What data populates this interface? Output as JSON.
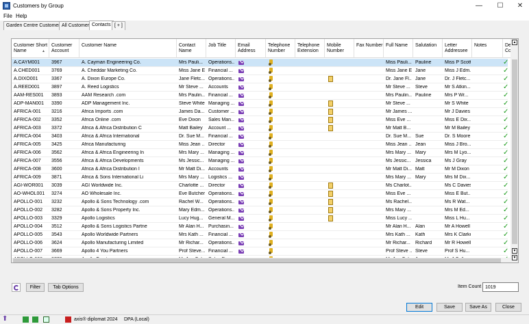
{
  "window": {
    "title": "Customers by Group",
    "minimize": "—",
    "maximize": "☐",
    "close": "✕"
  },
  "menu": [
    "File",
    "Help"
  ],
  "tabs": [
    "Garden Centre Customers",
    "All Customers",
    "Contacts",
    "[ + ]"
  ],
  "active_tab": 2,
  "columns": [
    {
      "label": "Customer Short Name"
    },
    {
      "label": "Customer Account"
    },
    {
      "label": "Customer Name"
    },
    {
      "label": "Contact Name"
    },
    {
      "label": "Job Title"
    },
    {
      "label": "Email Address"
    },
    {
      "label": "Telephone Number"
    },
    {
      "label": "Telephone Extension"
    },
    {
      "label": "Mobile Number"
    },
    {
      "label": "Fax Number"
    },
    {
      "label": "Full Name"
    },
    {
      "label": "Salutation"
    },
    {
      "label": "Letter Addressee"
    },
    {
      "label": "Notes"
    },
    {
      "label": "De Cu Co"
    }
  ],
  "rows": [
    {
      "short": "A.CAYM001",
      "acct": "3967",
      "name": "A. Cayman Engineering Co.",
      "contact": "Mrs Pauli...",
      "job": "Operations...",
      "mobile": false,
      "full": "Miss Pauli...",
      "sal": "Pauline",
      "addr": "Miss P Scott"
    },
    {
      "short": "A.CHED001",
      "acct": "3769",
      "name": "A. Cheddar Marketing Co.",
      "contact": "Miss Jane E...",
      "job": "Financial ...",
      "mobile": false,
      "full": "Miss Jane E...",
      "sal": "Jane",
      "addr": "Miss J Edm..."
    },
    {
      "short": "A.DIXO001",
      "acct": "3367",
      "name": "A. Dixon Europe Co.",
      "contact": "Jane Fletc...",
      "job": "Operations...",
      "mobile": true,
      "full": "Dr. Jane Fl...",
      "sal": "Jane",
      "addr": "Dr. J Fletc..."
    },
    {
      "short": "A.REED001",
      "acct": "3897",
      "name": "A. Reed Logistics",
      "contact": "Mr Steve ...",
      "job": "Accounts",
      "mobile": false,
      "full": "Mr Steve ...",
      "sal": "Steve",
      "addr": "Mr S Atkin..."
    },
    {
      "short": "AAM-RES001",
      "acct": "3893",
      "name": "AAM Research .com",
      "contact": "Mrs Paulin...",
      "job": "Financial ...",
      "mobile": false,
      "full": "Mrs Paulin...",
      "sal": "Pauline",
      "addr": "Mrs P Wr..."
    },
    {
      "short": "ADP-MAN001",
      "acct": "3390",
      "name": "ADP Management Inc.",
      "contact": "Steve White",
      "job": "Managing ...",
      "mobile": true,
      "full": "Mr Steve ...",
      "sal": "",
      "addr": "Mr S White"
    },
    {
      "short": "AFRICA-001",
      "acct": "3216",
      "name": "Africa Imports .com",
      "contact": "James Da...",
      "job": "Customer ...",
      "mobile": true,
      "full": "Mr James ...",
      "sal": "",
      "addr": "Mr J Davies"
    },
    {
      "short": "AFRICA-002",
      "acct": "3352",
      "name": "Africa Online .com",
      "contact": "Eve Dixon",
      "job": "Sales Man...",
      "mobile": true,
      "full": "Miss Eve ...",
      "sal": "",
      "addr": "Miss E Dix..."
    },
    {
      "short": "AFRICA-003",
      "acct": "3372",
      "name": "Africa & Africa Distribution C",
      "contact": "Matt Bailey",
      "job": "Account ...",
      "mobile": true,
      "full": "Mr Matt B...",
      "sal": "",
      "addr": "Mr M Bailey"
    },
    {
      "short": "AFRICA-004",
      "acct": "3403",
      "name": "Africa & Africa International",
      "contact": "Dr. Sue M...",
      "job": "Financial ...",
      "mobile": false,
      "full": "Dr. Sue M...",
      "sal": "Sue",
      "addr": "Dr. S Moore"
    },
    {
      "short": "AFRICA-005",
      "acct": "3425",
      "name": "Africa Manufacturing",
      "contact": "Miss Jean ...",
      "job": "Director",
      "mobile": false,
      "full": "Miss Jean ...",
      "sal": "Jean",
      "addr": "Miss J Bro..."
    },
    {
      "short": "AFRICA-006",
      "acct": "3562",
      "name": "Africa & Africa Engineering In",
      "contact": "Mrs Mary ...",
      "job": "Managing ...",
      "mobile": false,
      "full": "Mrs Mary ...",
      "sal": "Mary",
      "addr": "Mrs M Lyo..."
    },
    {
      "short": "AFRICA-007",
      "acct": "3556",
      "name": "Africa & Africa Developments",
      "contact": "Ms Jessic...",
      "job": "Managing ...",
      "mobile": false,
      "full": "Ms Jessic...",
      "sal": "Jessica",
      "addr": "Ms J Gray"
    },
    {
      "short": "AFRICA-008",
      "acct": "3600",
      "name": "Africa & Africa Distribution I",
      "contact": "Mr Matt Di...",
      "job": "Accounts",
      "mobile": false,
      "full": "Mr Matt Di...",
      "sal": "Matt",
      "addr": "Mr M Dixon"
    },
    {
      "short": "AFRICA-009",
      "acct": "3871",
      "name": "Africa & Sons International Li",
      "contact": "Mrs Mary ...",
      "job": "Logistics ...",
      "mobile": false,
      "full": "Mrs Mary ...",
      "sal": "Mary",
      "addr": "Mrs M Dix..."
    },
    {
      "short": "AGI-WOR001",
      "acct": "3039",
      "name": "AGI Worldwide Inc.",
      "contact": "Charlotte ...",
      "job": "Director",
      "mobile": true,
      "full": "Ms Charlot...",
      "sal": "",
      "addr": "Ms C Davies"
    },
    {
      "short": "AO-WHOL001",
      "acct": "3274",
      "name": "AO Wholesale Inc.",
      "contact": "Eve Butcher",
      "job": "Operations...",
      "mobile": true,
      "full": "Miss Eve ...",
      "sal": "",
      "addr": "Miss E But..."
    },
    {
      "short": "APOLLO-001",
      "acct": "3232",
      "name": "Apollo & Sons Technology .com",
      "contact": "Rachel W...",
      "job": "Operations...",
      "mobile": true,
      "full": "Ms Rachel...",
      "sal": "",
      "addr": "Ms R Wat..."
    },
    {
      "short": "APOLLO-002",
      "acct": "3282",
      "name": "Apollo & Sons Property Inc.",
      "contact": "Mary Edm...",
      "job": "Operations...",
      "mobile": true,
      "full": "Mrs Mary ...",
      "sal": "",
      "addr": "Mrs M Ed..."
    },
    {
      "short": "APOLLO-003",
      "acct": "3329",
      "name": "Apollo Logistics",
      "contact": "Lucy Hug...",
      "job": "General M...",
      "mobile": true,
      "full": "Miss Lucy ...",
      "sal": "",
      "addr": "Miss L Hu..."
    },
    {
      "short": "APOLLO-004",
      "acct": "3512",
      "name": "Apollo & Sons Logistics Partne",
      "contact": "Mr Alan H...",
      "job": "Purchasin...",
      "mobile": false,
      "full": "Mr Alan H...",
      "sal": "Alan",
      "addr": "Mr A Howell"
    },
    {
      "short": "APOLLO-005",
      "acct": "3543",
      "name": "Apollo Worldwide Partners",
      "contact": "Mrs Kath ...",
      "job": "Financial ...",
      "mobile": false,
      "full": "Mrs Kath ...",
      "sal": "Kath",
      "addr": "Mrs K Clarke"
    },
    {
      "short": "APOLLO-006",
      "acct": "3624",
      "name": "Apollo Manufacturing Limited",
      "contact": "Mr Richar...",
      "job": "Operations...",
      "mobile": false,
      "full": "Mr Richar...",
      "sal": "Richard",
      "addr": "Mr R Howell"
    },
    {
      "short": "APOLLO-007",
      "acct": "3669",
      "name": "Apollo 4 You Partners",
      "contact": "Prof Steve...",
      "job": "Financial ...",
      "mobile": false,
      "full": "Prof Steve ...",
      "sal": "Steve",
      "addr": "Prof S Hu..."
    },
    {
      "short": "APOLLO-008",
      "acct": "3772",
      "name": "Apollo Frost",
      "contact": "Mr Jon Cal...",
      "job": "Sales Dire...",
      "mobile": false,
      "full": "Mr Jon Cal...",
      "sal": "Jon",
      "addr": "Mr J Calla..."
    }
  ],
  "buttons": {
    "filter": "Filter",
    "tab_options": "Tab Options",
    "edit": "Edit",
    "save": "Save",
    "save_as": "Save As",
    "close": "Close"
  },
  "item_count": {
    "label": "Item Count",
    "value": "1019"
  },
  "status": {
    "product": "axis® diplomat 2024",
    "database": "DPA (Local)"
  },
  "colors": {
    "selection": "#cce4f7",
    "email_icon": "#7b3fb5",
    "tick": "#1a9a1a"
  }
}
